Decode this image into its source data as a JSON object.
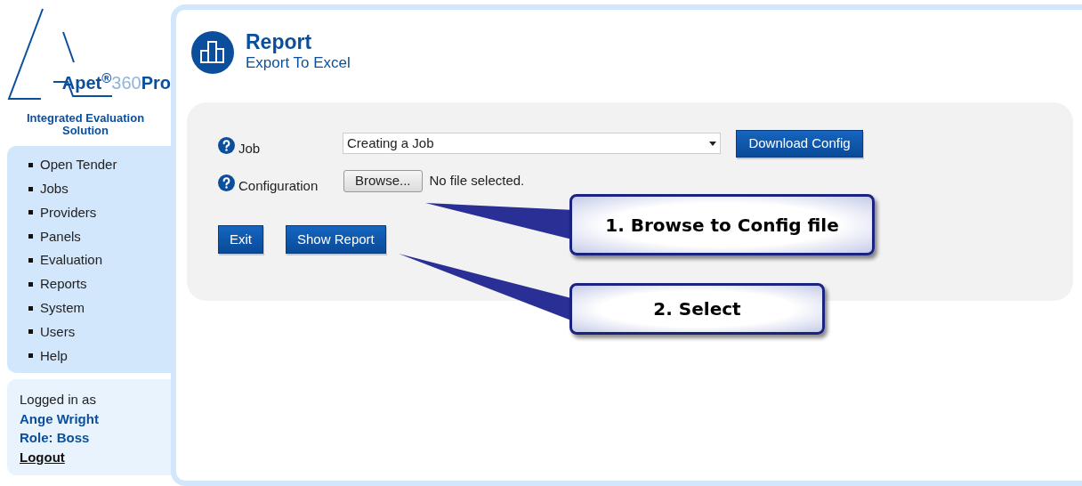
{
  "logo": {
    "brand": "Apet$^{®}$",
    "number": "360",
    "suffix": "Pro",
    "tagline": "Integrated Evaluation Solution"
  },
  "nav": {
    "items": [
      "Open Tender",
      "Jobs",
      "Providers",
      "Panels",
      "Evaluation",
      "Reports",
      "System",
      "Users",
      "Help"
    ]
  },
  "login": {
    "label": "Logged in as",
    "user": "Ange Wright",
    "role": "Role: Boss",
    "logout": "Logout"
  },
  "header": {
    "title": "Report",
    "subtitle": "Export To Excel"
  },
  "form": {
    "fields": [
      {
        "kind": "select",
        "label": "Job",
        "value": "Creating a Job",
        "action": "Download Config"
      },
      {
        "kind": "file",
        "label": "Configuration",
        "button": "Browse...",
        "status": "No file selected."
      }
    ],
    "buttons": [
      "Exit",
      "Show Report"
    ]
  },
  "callouts": [
    "1. Browse to Config file",
    "2. Select"
  ]
}
